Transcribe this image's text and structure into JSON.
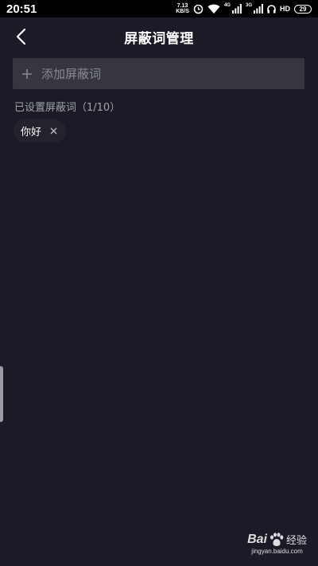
{
  "status_bar": {
    "time": "20:51",
    "speed_value": "7.13",
    "speed_unit": "KB/S",
    "network_tag_1": "4G",
    "network_tag_2": "3G",
    "hd_label": "HD",
    "battery": "29"
  },
  "header": {
    "title": "屏蔽词管理",
    "back_icon": "chevron-left-icon"
  },
  "add_input": {
    "placeholder": "添加屏蔽词",
    "value": "",
    "icon": "plus-icon"
  },
  "section": {
    "label": "已设置屏蔽词（1/10）"
  },
  "blocked_words": [
    {
      "label": "你好",
      "remove_icon": "close-icon"
    }
  ],
  "watermark": {
    "brand": "Bai",
    "brand_suffix": "经验",
    "url": "jingyan.baidu.com"
  },
  "colors": {
    "background": "#1a1b26",
    "input_bg": "#35363f",
    "chip_bg": "#22232d",
    "muted_text": "#a2a3a9"
  }
}
